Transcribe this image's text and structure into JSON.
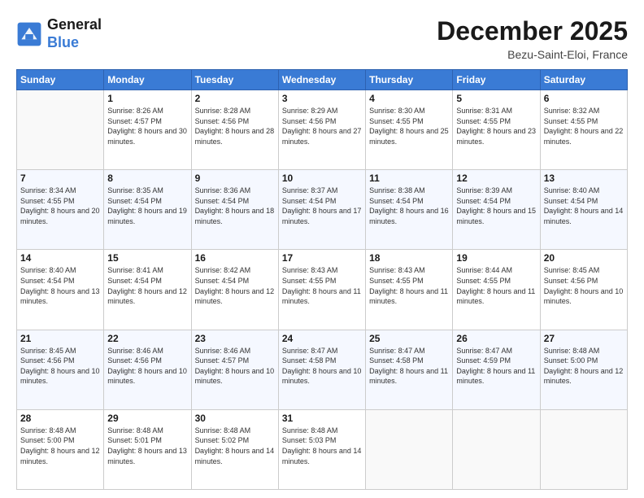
{
  "logo": {
    "text_general": "General",
    "text_blue": "Blue"
  },
  "title": "December 2025",
  "location": "Bezu-Saint-Eloi, France",
  "days_of_week": [
    "Sunday",
    "Monday",
    "Tuesday",
    "Wednesday",
    "Thursday",
    "Friday",
    "Saturday"
  ],
  "weeks": [
    [
      {
        "day": "",
        "sunrise": "",
        "sunset": "",
        "daylight": ""
      },
      {
        "day": "1",
        "sunrise": "Sunrise: 8:26 AM",
        "sunset": "Sunset: 4:57 PM",
        "daylight": "Daylight: 8 hours and 30 minutes."
      },
      {
        "day": "2",
        "sunrise": "Sunrise: 8:28 AM",
        "sunset": "Sunset: 4:56 PM",
        "daylight": "Daylight: 8 hours and 28 minutes."
      },
      {
        "day": "3",
        "sunrise": "Sunrise: 8:29 AM",
        "sunset": "Sunset: 4:56 PM",
        "daylight": "Daylight: 8 hours and 27 minutes."
      },
      {
        "day": "4",
        "sunrise": "Sunrise: 8:30 AM",
        "sunset": "Sunset: 4:55 PM",
        "daylight": "Daylight: 8 hours and 25 minutes."
      },
      {
        "day": "5",
        "sunrise": "Sunrise: 8:31 AM",
        "sunset": "Sunset: 4:55 PM",
        "daylight": "Daylight: 8 hours and 23 minutes."
      },
      {
        "day": "6",
        "sunrise": "Sunrise: 8:32 AM",
        "sunset": "Sunset: 4:55 PM",
        "daylight": "Daylight: 8 hours and 22 minutes."
      }
    ],
    [
      {
        "day": "7",
        "sunrise": "Sunrise: 8:34 AM",
        "sunset": "Sunset: 4:55 PM",
        "daylight": "Daylight: 8 hours and 20 minutes."
      },
      {
        "day": "8",
        "sunrise": "Sunrise: 8:35 AM",
        "sunset": "Sunset: 4:54 PM",
        "daylight": "Daylight: 8 hours and 19 minutes."
      },
      {
        "day": "9",
        "sunrise": "Sunrise: 8:36 AM",
        "sunset": "Sunset: 4:54 PM",
        "daylight": "Daylight: 8 hours and 18 minutes."
      },
      {
        "day": "10",
        "sunrise": "Sunrise: 8:37 AM",
        "sunset": "Sunset: 4:54 PM",
        "daylight": "Daylight: 8 hours and 17 minutes."
      },
      {
        "day": "11",
        "sunrise": "Sunrise: 8:38 AM",
        "sunset": "Sunset: 4:54 PM",
        "daylight": "Daylight: 8 hours and 16 minutes."
      },
      {
        "day": "12",
        "sunrise": "Sunrise: 8:39 AM",
        "sunset": "Sunset: 4:54 PM",
        "daylight": "Daylight: 8 hours and 15 minutes."
      },
      {
        "day": "13",
        "sunrise": "Sunrise: 8:40 AM",
        "sunset": "Sunset: 4:54 PM",
        "daylight": "Daylight: 8 hours and 14 minutes."
      }
    ],
    [
      {
        "day": "14",
        "sunrise": "Sunrise: 8:40 AM",
        "sunset": "Sunset: 4:54 PM",
        "daylight": "Daylight: 8 hours and 13 minutes."
      },
      {
        "day": "15",
        "sunrise": "Sunrise: 8:41 AM",
        "sunset": "Sunset: 4:54 PM",
        "daylight": "Daylight: 8 hours and 12 minutes."
      },
      {
        "day": "16",
        "sunrise": "Sunrise: 8:42 AM",
        "sunset": "Sunset: 4:54 PM",
        "daylight": "Daylight: 8 hours and 12 minutes."
      },
      {
        "day": "17",
        "sunrise": "Sunrise: 8:43 AM",
        "sunset": "Sunset: 4:55 PM",
        "daylight": "Daylight: 8 hours and 11 minutes."
      },
      {
        "day": "18",
        "sunrise": "Sunrise: 8:43 AM",
        "sunset": "Sunset: 4:55 PM",
        "daylight": "Daylight: 8 hours and 11 minutes."
      },
      {
        "day": "19",
        "sunrise": "Sunrise: 8:44 AM",
        "sunset": "Sunset: 4:55 PM",
        "daylight": "Daylight: 8 hours and 11 minutes."
      },
      {
        "day": "20",
        "sunrise": "Sunrise: 8:45 AM",
        "sunset": "Sunset: 4:56 PM",
        "daylight": "Daylight: 8 hours and 10 minutes."
      }
    ],
    [
      {
        "day": "21",
        "sunrise": "Sunrise: 8:45 AM",
        "sunset": "Sunset: 4:56 PM",
        "daylight": "Daylight: 8 hours and 10 minutes."
      },
      {
        "day": "22",
        "sunrise": "Sunrise: 8:46 AM",
        "sunset": "Sunset: 4:56 PM",
        "daylight": "Daylight: 8 hours and 10 minutes."
      },
      {
        "day": "23",
        "sunrise": "Sunrise: 8:46 AM",
        "sunset": "Sunset: 4:57 PM",
        "daylight": "Daylight: 8 hours and 10 minutes."
      },
      {
        "day": "24",
        "sunrise": "Sunrise: 8:47 AM",
        "sunset": "Sunset: 4:58 PM",
        "daylight": "Daylight: 8 hours and 10 minutes."
      },
      {
        "day": "25",
        "sunrise": "Sunrise: 8:47 AM",
        "sunset": "Sunset: 4:58 PM",
        "daylight": "Daylight: 8 hours and 11 minutes."
      },
      {
        "day": "26",
        "sunrise": "Sunrise: 8:47 AM",
        "sunset": "Sunset: 4:59 PM",
        "daylight": "Daylight: 8 hours and 11 minutes."
      },
      {
        "day": "27",
        "sunrise": "Sunrise: 8:48 AM",
        "sunset": "Sunset: 5:00 PM",
        "daylight": "Daylight: 8 hours and 12 minutes."
      }
    ],
    [
      {
        "day": "28",
        "sunrise": "Sunrise: 8:48 AM",
        "sunset": "Sunset: 5:00 PM",
        "daylight": "Daylight: 8 hours and 12 minutes."
      },
      {
        "day": "29",
        "sunrise": "Sunrise: 8:48 AM",
        "sunset": "Sunset: 5:01 PM",
        "daylight": "Daylight: 8 hours and 13 minutes."
      },
      {
        "day": "30",
        "sunrise": "Sunrise: 8:48 AM",
        "sunset": "Sunset: 5:02 PM",
        "daylight": "Daylight: 8 hours and 14 minutes."
      },
      {
        "day": "31",
        "sunrise": "Sunrise: 8:48 AM",
        "sunset": "Sunset: 5:03 PM",
        "daylight": "Daylight: 8 hours and 14 minutes."
      },
      {
        "day": "",
        "sunrise": "",
        "sunset": "",
        "daylight": ""
      },
      {
        "day": "",
        "sunrise": "",
        "sunset": "",
        "daylight": ""
      },
      {
        "day": "",
        "sunrise": "",
        "sunset": "",
        "daylight": ""
      }
    ]
  ]
}
